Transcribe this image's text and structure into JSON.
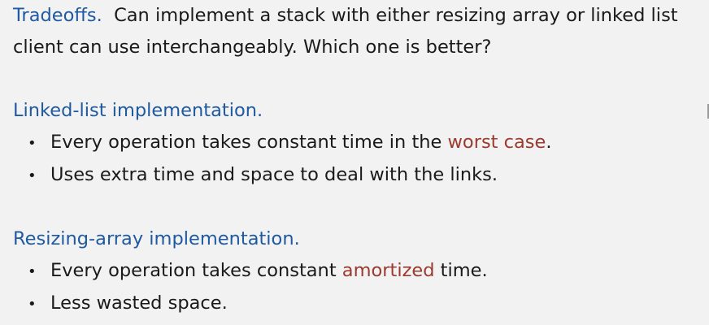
{
  "intro": {
    "label": "Tradeoffs.",
    "text1": "Can implement a stack with either resizing array or linked list",
    "text2": "client can use interchangeably.  Which one is better?"
  },
  "linked": {
    "heading": "Linked-list implementation.",
    "bullets": [
      {
        "pre": "Every operation takes constant time in the ",
        "hi": "worst case",
        "post": "."
      },
      {
        "text": "Uses extra time and space to deal with the links."
      }
    ]
  },
  "resizing": {
    "heading": "Resizing-array implementation.",
    "bullets": [
      {
        "pre": "Every operation takes constant ",
        "hi": "amortized",
        "post": " time."
      },
      {
        "text": "Less wasted space."
      }
    ]
  },
  "bullet_glyph": "•",
  "colors": {
    "heading": "#1f5aa0",
    "highlight": "#9b3a2e",
    "text": "#1a1a1a",
    "background": "#f2f2f2"
  }
}
